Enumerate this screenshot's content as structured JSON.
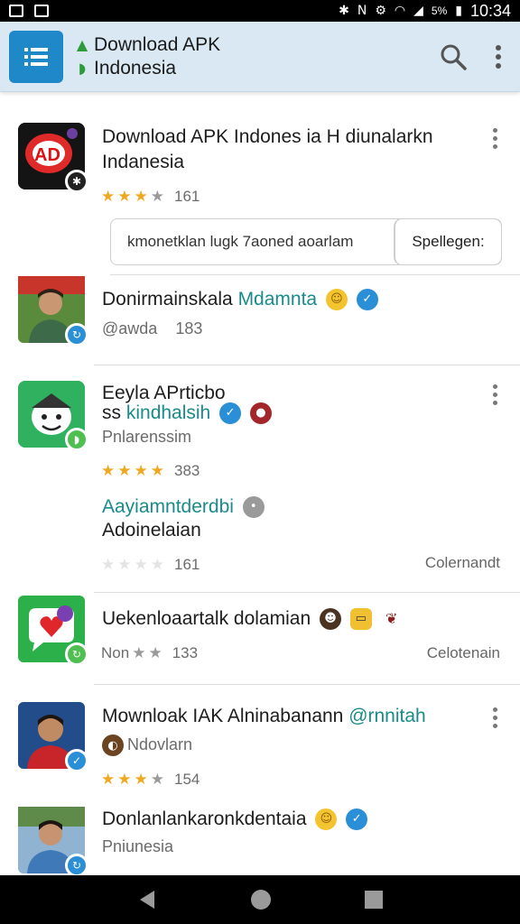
{
  "status": {
    "battery": "5%",
    "time": "10:34"
  },
  "appbar": {
    "line1": "Download APK",
    "line2": "Indonesia"
  },
  "items": [
    {
      "title_line1": "Download APK Indones ia  H diunalarkn",
      "title_line2": "Indanesia",
      "rating_num": "161",
      "search_text": "kmonetklan lugk 7aoned aoarlam",
      "search_button": "Spellegen:"
    },
    {
      "title": "Donirmainskala ",
      "title_teal": "Mdamnta",
      "sub": "@awda",
      "sub_num": "183"
    },
    {
      "title_line1": "Eeyla APrticbo",
      "title_line2_a": "ss ",
      "title_line2_teal": "kindhalsih",
      "sub": "Pnlarenssim",
      "rating_num": "383",
      "extra_teal": "Aayiamntderdbi",
      "extra_line2": "Adoinelaian",
      "rating2_num": "161",
      "right_label": "Colernandt"
    },
    {
      "title": "Uekenloaartalk dolamian",
      "rating_prefix": "Non",
      "rating_num": "133",
      "right_label": "Celotenain"
    },
    {
      "title_a": "Mownloak IAK Alninabanann ",
      "title_teal": "@rnnitah",
      "sub": "Ndovlarn",
      "rating_num": "154"
    },
    {
      "title": "Donlanlankaronkdentaia",
      "sub": "Pniunesia"
    }
  ],
  "icons": {
    "nav": [
      "back-icon",
      "home-icon",
      "recents-icon"
    ],
    "appbar": [
      "menu-icon",
      "search-icon",
      "overflow-menu-icon"
    ]
  },
  "colors": {
    "appbar_bg": "#d9e8f2",
    "accent": "#1e88c9",
    "star": "#f0a820",
    "teal": "#1a8a8a"
  }
}
